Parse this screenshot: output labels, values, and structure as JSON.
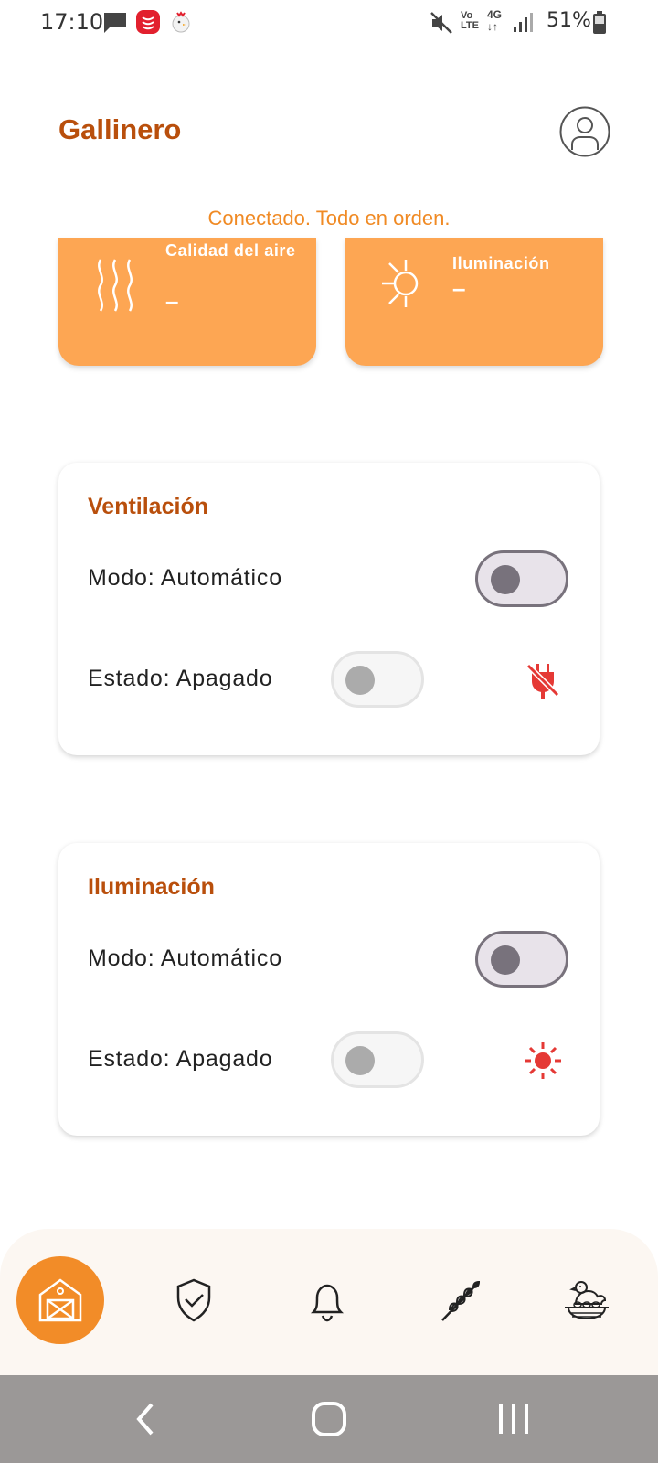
{
  "status_bar": {
    "time": "17:10",
    "battery": "51%",
    "network": "4G",
    "lte": "LTE"
  },
  "header": {
    "title": "Gallinero",
    "profile_icon": "account-circle-icon"
  },
  "connection_status": "Conectado. Todo en orden.",
  "sensors": [
    {
      "label": "Calidad del aire",
      "value": "–",
      "icon": "air-waves-icon"
    },
    {
      "label": "Iluminación",
      "value": "–",
      "icon": "sun-icon"
    }
  ],
  "ventilation": {
    "title": "Ventilación",
    "mode_label": "Modo: Automático",
    "mode_on": false,
    "state_label": "Estado: Apagado",
    "state_on": false,
    "state_icon": "power-off-icon"
  },
  "lighting": {
    "title": "Iluminación",
    "mode_label": "Modo: Automático",
    "mode_on": false,
    "state_label": "Estado: Apagado",
    "state_on": false,
    "state_icon": "sun-red-icon"
  },
  "bottom_nav": [
    {
      "icon": "barn-icon",
      "active": true
    },
    {
      "icon": "shield-check-icon",
      "active": false
    },
    {
      "icon": "bell-icon",
      "active": false
    },
    {
      "icon": "wheat-icon",
      "active": false
    },
    {
      "icon": "hen-nest-icon",
      "active": false
    }
  ],
  "colors": {
    "accent": "#F28C28",
    "title": "#B94F0C",
    "sensor_card": "#FDA653",
    "status_text": "#F08A24",
    "alert_red": "#E53935"
  }
}
